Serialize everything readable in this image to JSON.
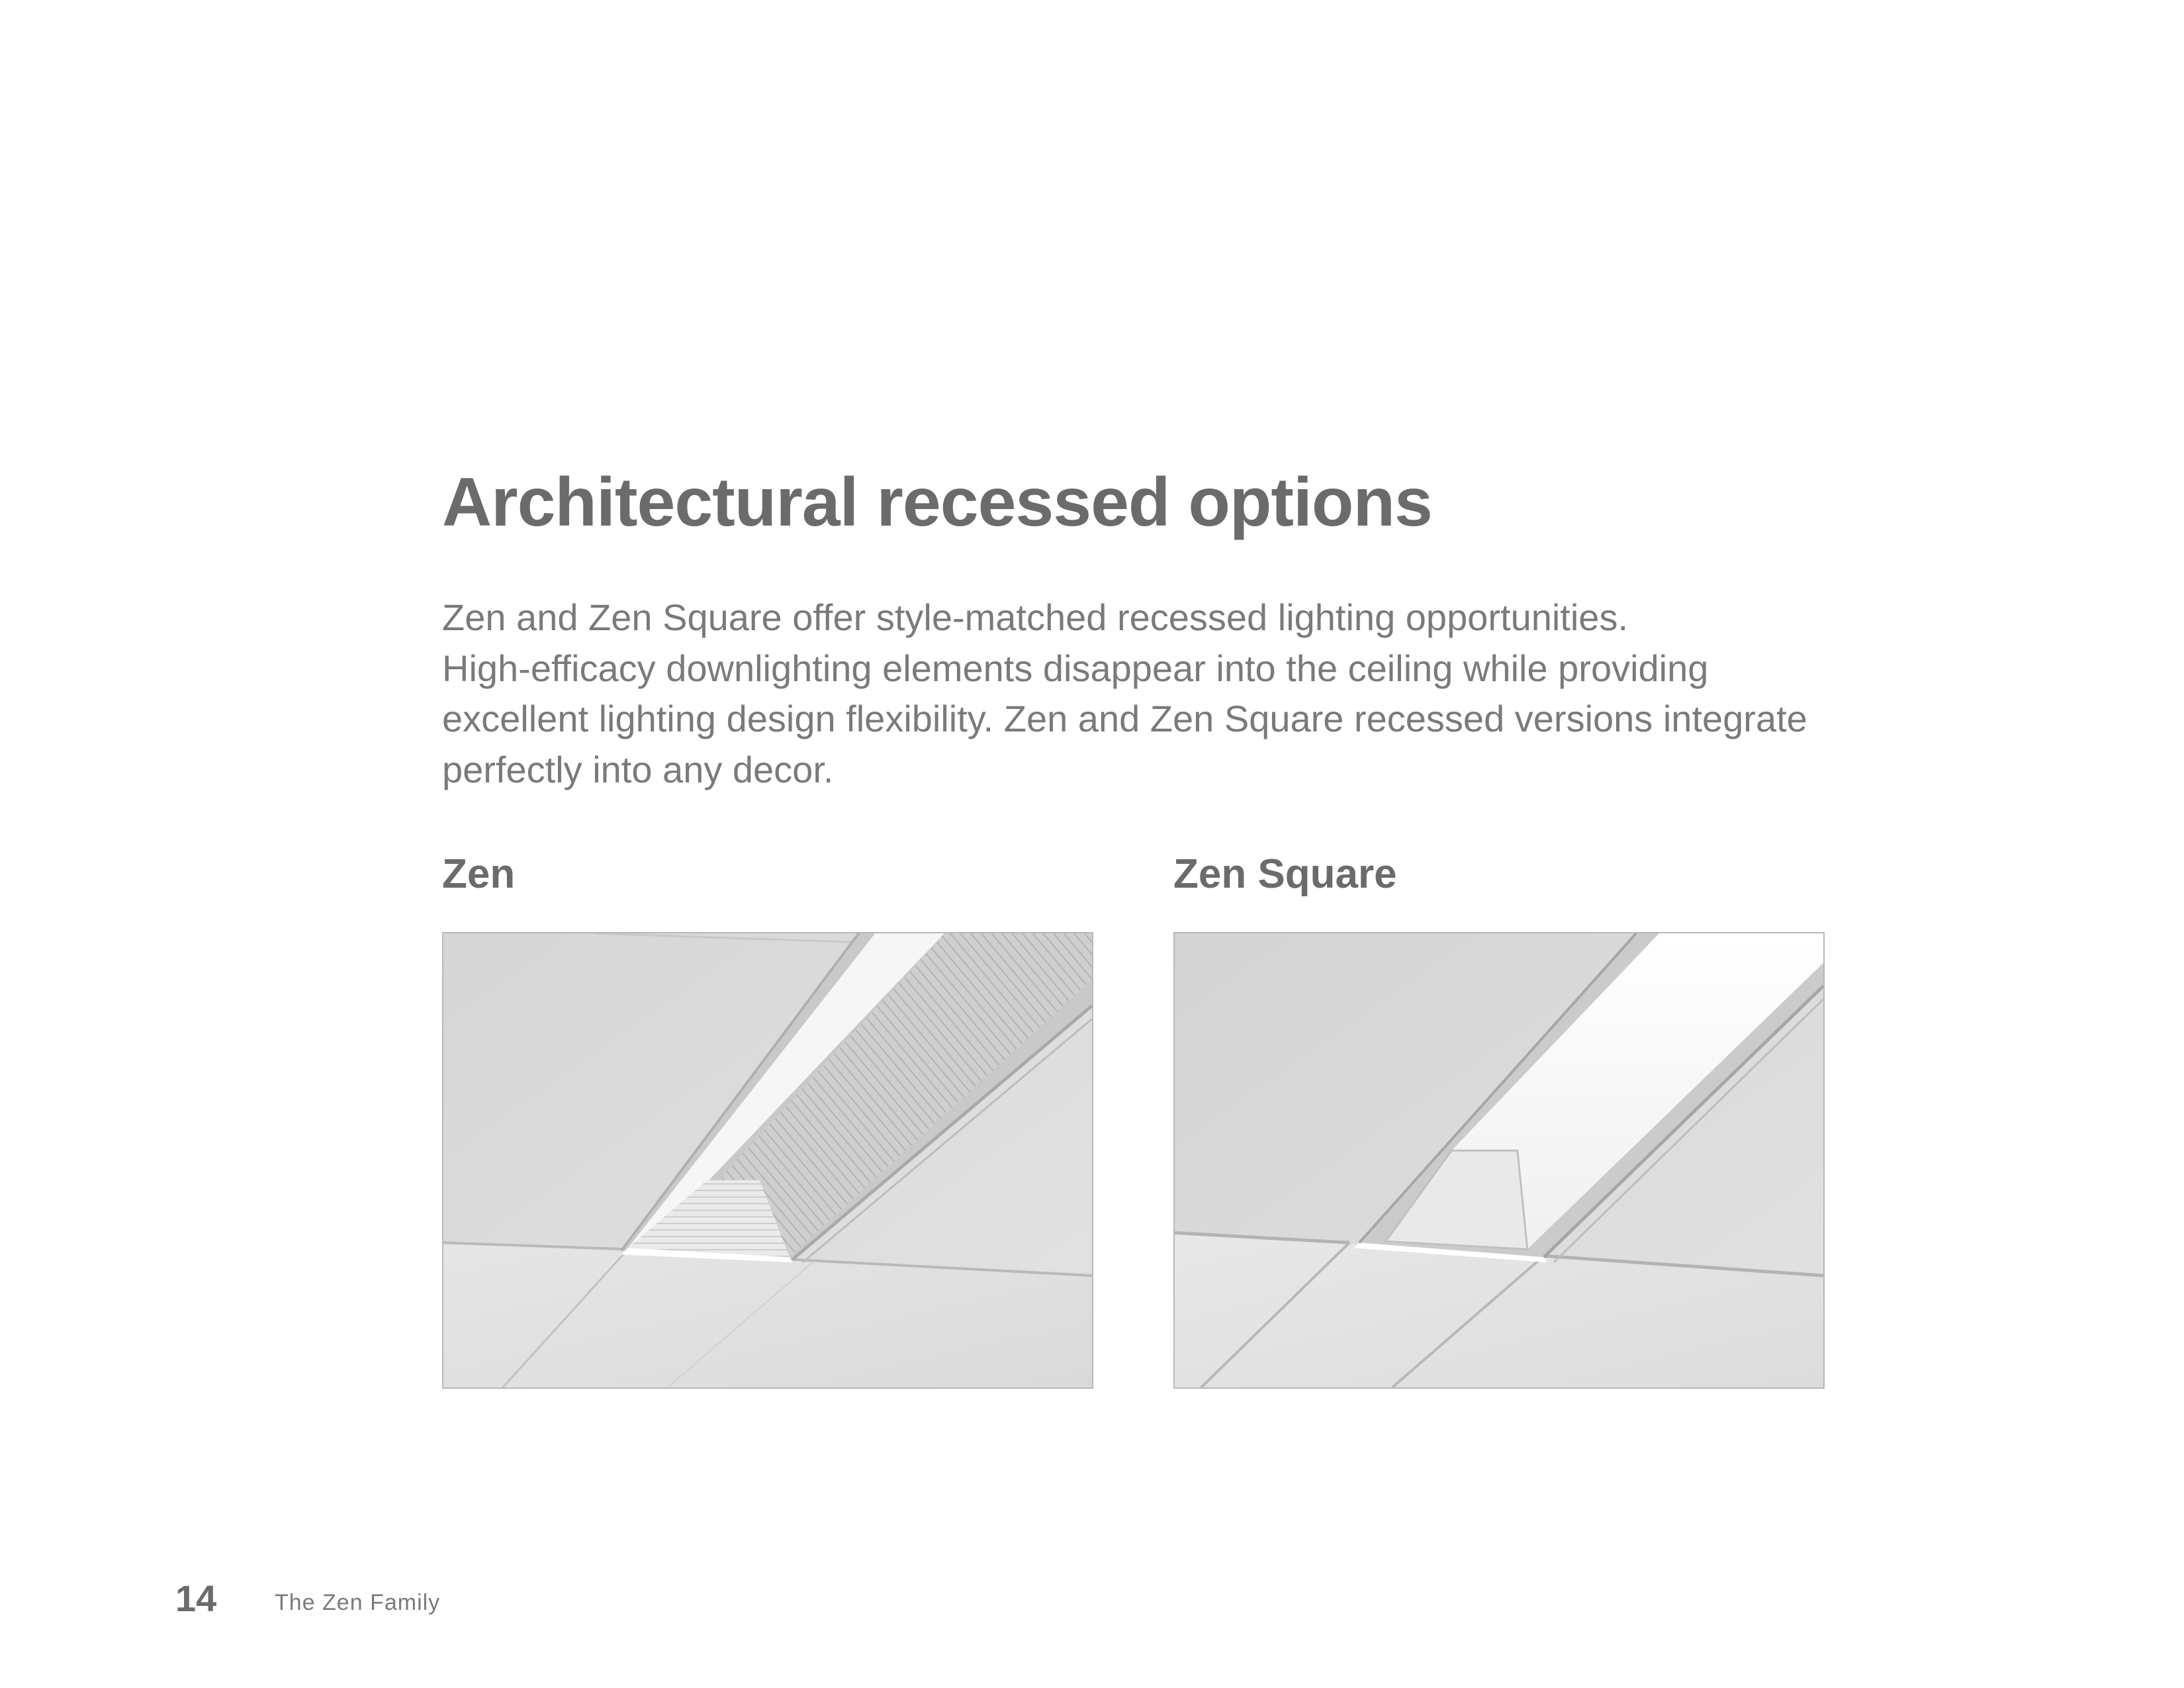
{
  "page": {
    "title": "Architectural recessed options",
    "body_lines": [
      "Zen and Zen Square offer style-matched recessed lighting opportunities.",
      "High-efficacy downlighting elements disappear into the ceiling while providing",
      "excellent lighting design flexibility. Zen and Zen Square recessed versions integrate",
      "perfectly into any decor."
    ]
  },
  "figures": [
    {
      "label": "Zen"
    },
    {
      "label": "Zen Square"
    }
  ],
  "footer": {
    "page_number": "14",
    "section": "The Zen Family"
  }
}
